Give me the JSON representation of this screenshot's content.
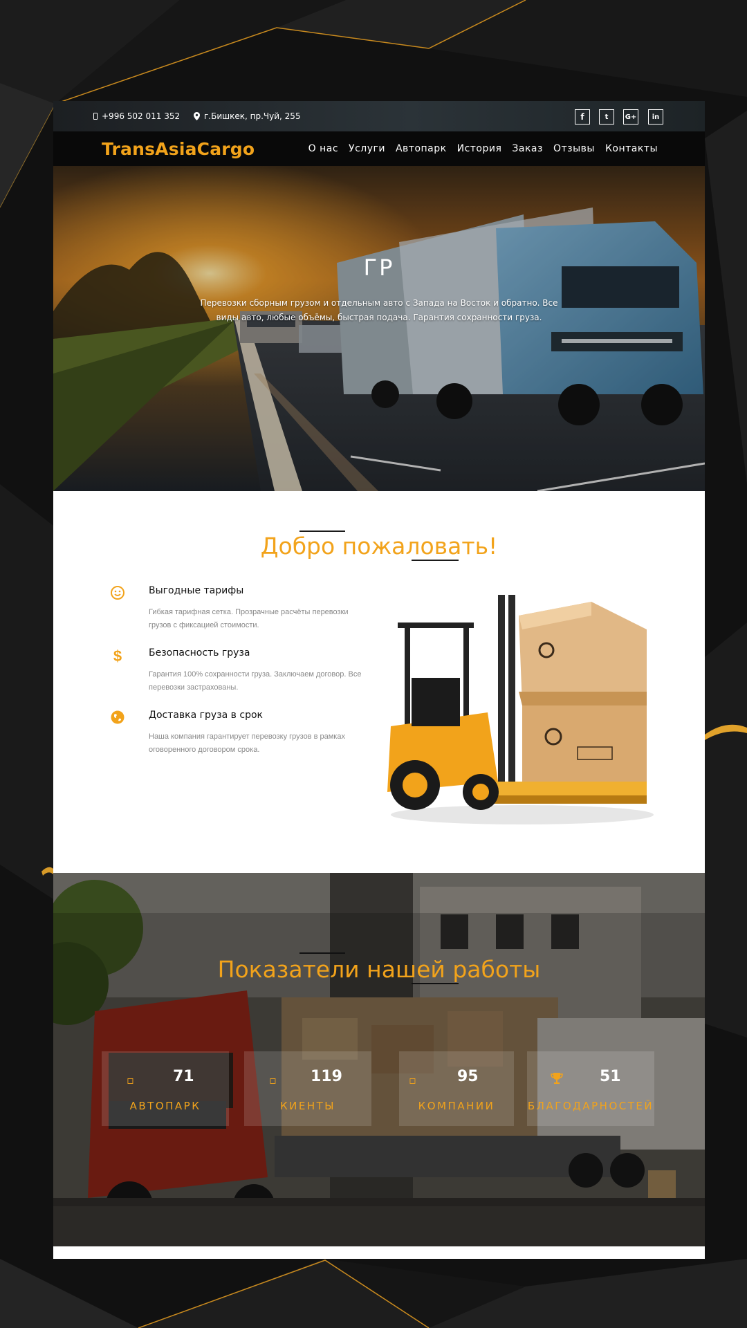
{
  "topbar": {
    "phone": "+996 502 011 352",
    "address": "г.Бишкек, пр.Чуй, 255",
    "social": [
      {
        "name": "facebook-icon",
        "glyph": "f"
      },
      {
        "name": "twitter-icon",
        "glyph": "t"
      },
      {
        "name": "google-plus-icon",
        "glyph": "G+"
      },
      {
        "name": "linkedin-icon",
        "glyph": "in"
      }
    ]
  },
  "header": {
    "logo": "TransAsiaCargo",
    "nav": [
      "О нас",
      "Услуги",
      "Автопарк",
      "История",
      "Заказ",
      "Отзывы",
      "Контакты"
    ]
  },
  "hero": {
    "title": "ГР",
    "text": "Перевозки сборным грузом и отдельным авто с Запада на Восток и обратно. Все виды авто, любые объёмы, быстрая подача. Гарантия сохранности груза."
  },
  "welcome": {
    "title": "Добро пожаловать!",
    "features": [
      {
        "icon": "smile-icon",
        "title": "Выгодные тарифы",
        "text": "Гибкая тарифная сетка. Прозрачные расчёты перевозки грузов с фиксацией стоимости."
      },
      {
        "icon": "dollar-icon",
        "title": "Безопасность груза",
        "text": "Гарантия 100% сохранности груза. Заключаем договор. Все перевозки застрахованы."
      },
      {
        "icon": "globe-icon",
        "title": "Доставка груза в срок",
        "text": "Наша компания гарантирует перевозку грузов в рамках оговоренного договором срока."
      }
    ]
  },
  "stats": {
    "title": "Показатели нашей работы",
    "items": [
      {
        "icon": "fleet-icon",
        "value": "71",
        "label": "АВТОПАРК"
      },
      {
        "icon": "clients-icon",
        "value": "119",
        "label": "КИЕНТЫ"
      },
      {
        "icon": "companies-icon",
        "value": "95",
        "label": "КОМПАНИИ"
      },
      {
        "icon": "trophy-icon",
        "value": "51",
        "label": "БЛАГОДАРНОСТЕЙ"
      }
    ]
  },
  "colors": {
    "accent": "#f2a31b",
    "nav_bg": "#090909",
    "page_bg": "#121212"
  }
}
